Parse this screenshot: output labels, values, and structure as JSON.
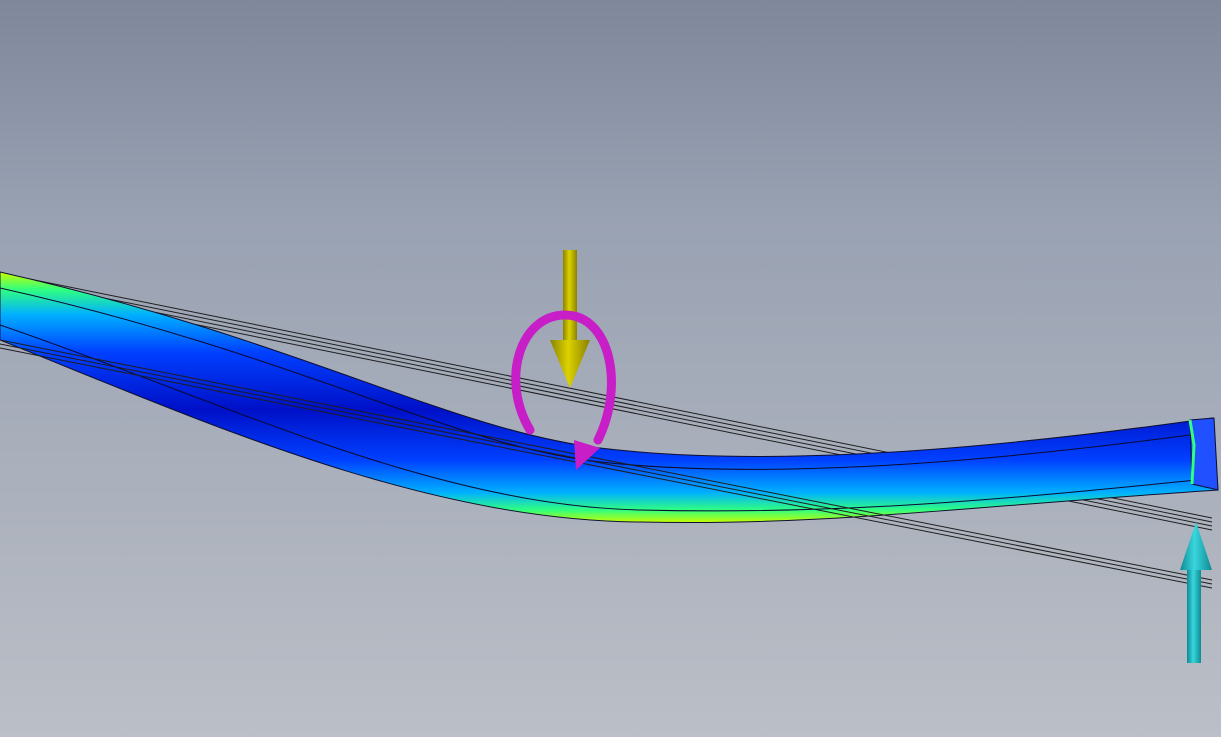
{
  "viewport": {
    "background_top": "#7f889b",
    "background_bottom": "#bbbfc7"
  },
  "model": {
    "deformed_beam": {
      "stress_colors": [
        "#0010c8",
        "#0040ff",
        "#00b0ff",
        "#30ff80",
        "#c8ff00"
      ]
    },
    "undeformed_outline": {
      "color": "#1e1e1e"
    }
  },
  "glyphs": {
    "force": {
      "icon": "force-arrow-down-icon",
      "color": "#c8be00"
    },
    "moment": {
      "icon": "moment-arrow-icon",
      "color": "#c81ec8"
    },
    "support": {
      "icon": "support-arrow-up-icon",
      "color": "#19bcc4"
    }
  }
}
